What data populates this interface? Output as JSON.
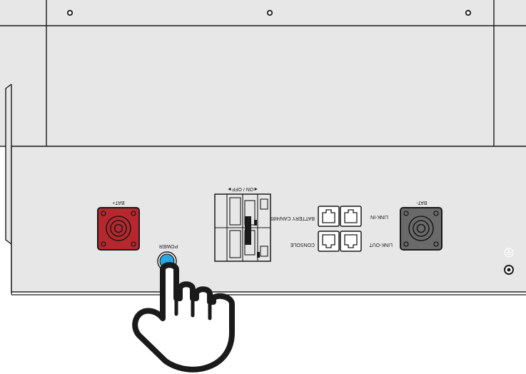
{
  "labels": {
    "bat_plus": "BAT+",
    "bat_minus": "BAT-",
    "power": "POWER",
    "on_off": "◄ON / OFF►",
    "battery_can": "BATTERY CAN/485",
    "link_in": "LINK-IN",
    "link_out": "LINK-OUT",
    "console": "CONSOLE"
  },
  "colors": {
    "panel": "#e6e7e6",
    "outline": "#1a1a1a",
    "bat_plus_terminal": "#b7282e",
    "bat_minus_terminal": "#6a6a6a",
    "power_button": "#29a8e0"
  },
  "icons": {
    "ground": "ground-symbol-icon",
    "hand": "pointing-hand-icon"
  }
}
